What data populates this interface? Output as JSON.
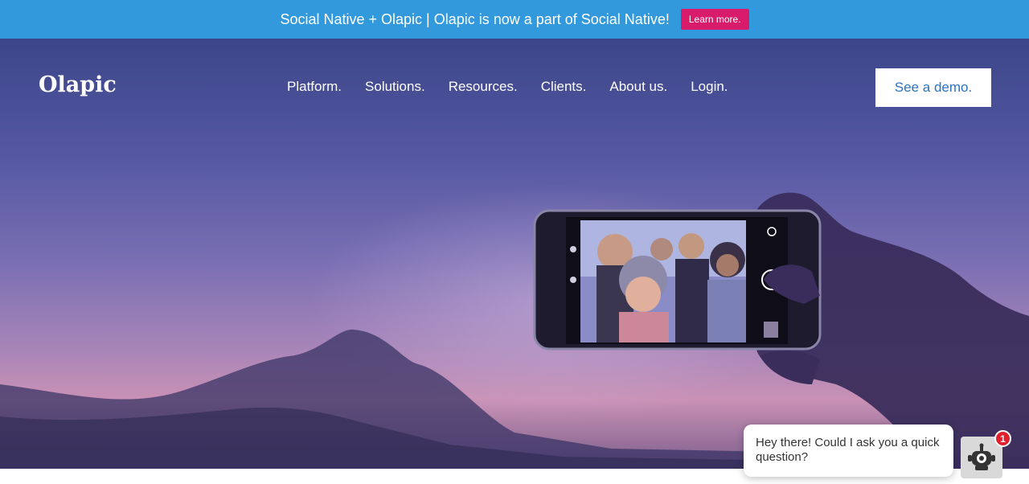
{
  "announcement": {
    "text": "Social Native + Olapic | Olapic is now a part of Social Native!",
    "cta_label": "Learn more."
  },
  "header": {
    "logo": "Olapic",
    "nav": [
      "Platform.",
      "Solutions.",
      "Resources.",
      "Clients.",
      "About us.",
      "Login."
    ],
    "demo_label": "See a demo."
  },
  "hero": {
    "image": "selfie-phone-sunset"
  },
  "chat": {
    "message": "Hey there! Could I ask you a quick question?",
    "badge_count": "1",
    "avatar_icon": "robot-icon"
  },
  "colors": {
    "announce_bar": "#3399dd",
    "learn_button": "#d81b6a",
    "demo_text": "#2a73c2",
    "badge": "#e0202f"
  }
}
